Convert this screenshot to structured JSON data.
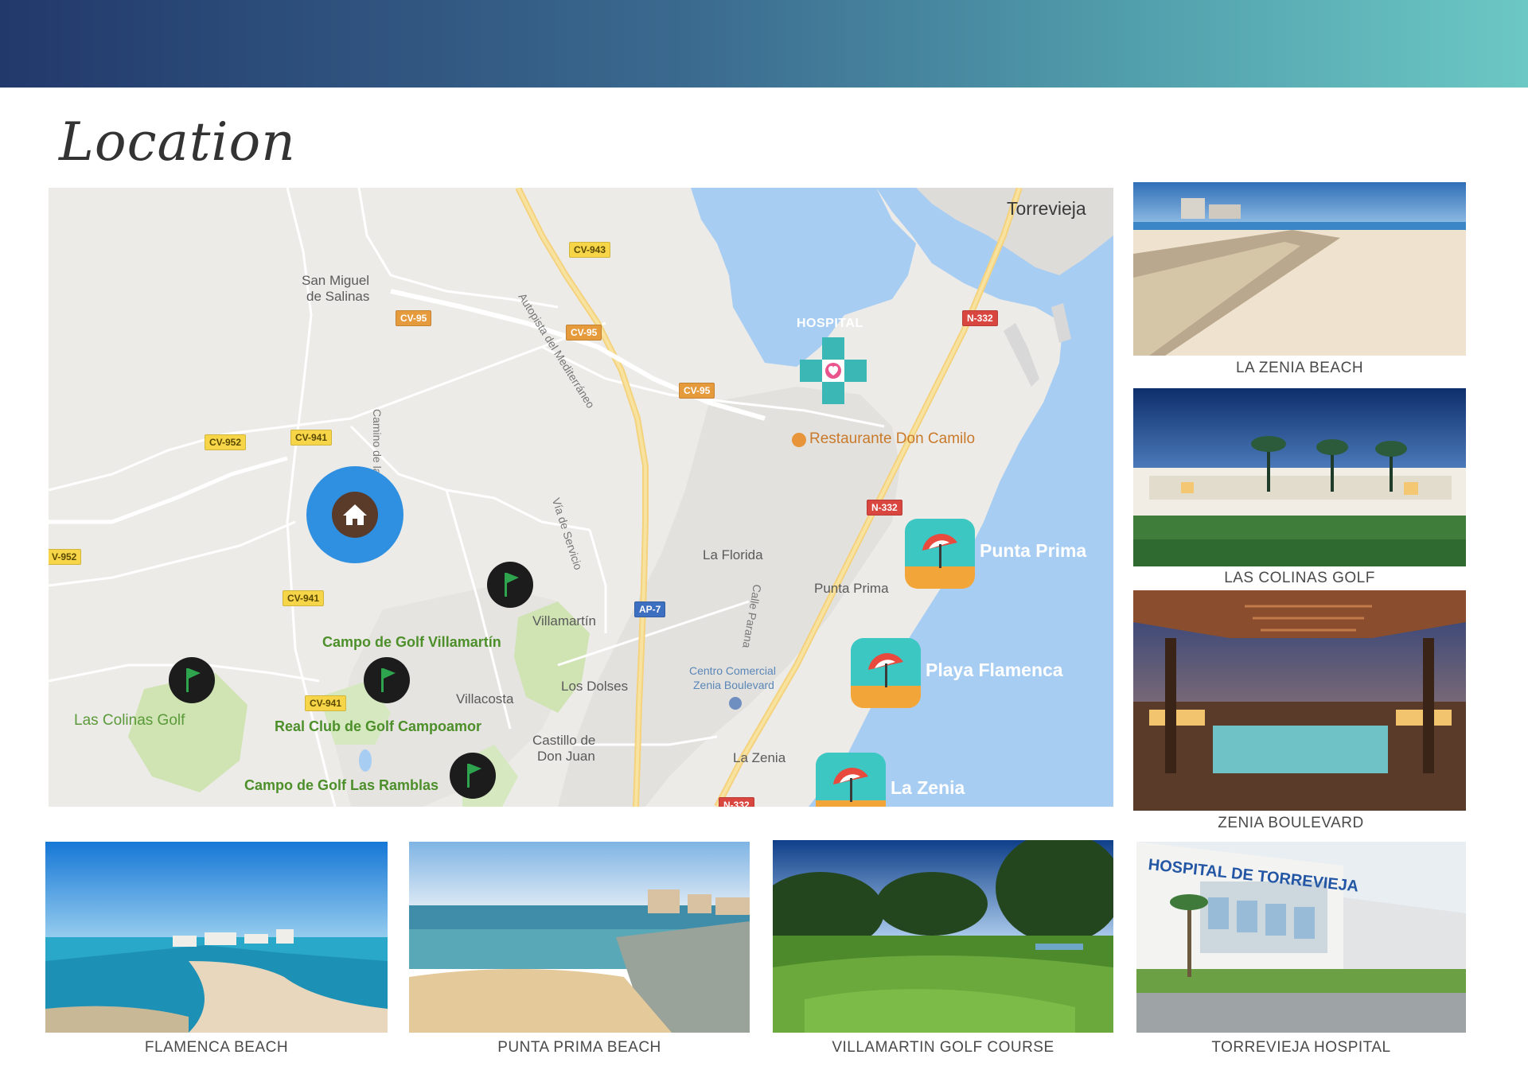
{
  "page": {
    "title": "Location"
  },
  "colors": {
    "header_start": "#22396b",
    "header_end": "#6cc8c4",
    "home_marker": "#2f8fe0",
    "golf": "#4d8f2a",
    "beach_icon": "#3cc7c3",
    "sea": "#a8cdf3"
  },
  "map": {
    "cities": {
      "torrevieja": "Torrevieja"
    },
    "towns": {
      "san_miguel_line1": "San Miguel",
      "san_miguel_line2": "de Salinas",
      "la_florida": "La Florida",
      "punta_prima": "Punta Prima",
      "villamartin": "Villamartín",
      "los_dolses": "Los Dolses",
      "villacosta": "Villacosta",
      "castillo_line1": "Castillo de",
      "castillo_line2": "Don Juan",
      "la_zenia": "La Zenia"
    },
    "streets": {
      "autopista": "Autopista del Mediterráneo",
      "camino": "Camino de la",
      "via_servicio": "Vía de Servicio",
      "calle": "Calle Parana"
    },
    "roads": {
      "cv943": "CV-943",
      "cv95_a": "CV-95",
      "cv95_b": "CV-95",
      "cv95_c": "CV-95",
      "n332_a": "N-332",
      "n332_b": "N-332",
      "n332_c": "N-332",
      "cv952_a": "CV-952",
      "cv952_b": "V-952",
      "cv941_a": "CV-941",
      "cv941_b": "CV-941",
      "cv941_c": "CV-941",
      "ap7": "AP-7"
    },
    "pois": {
      "hospital": "HOSPITAL",
      "restaurant": "Restaurante Don Camilo",
      "mall_line1": "Centro Comercial",
      "mall_line2": "Zenia Boulevard"
    },
    "golf": {
      "villamartin": "Campo de Golf Villamartín",
      "campoamor": "Real Club de Golf Campoamor",
      "las_ramblas": "Campo de Golf Las Ramblas",
      "las_colinas": "Las Colinas Golf"
    },
    "beaches": {
      "punta_prima": "Punta Prima",
      "playa_flamenca": "Playa Flamenca",
      "la_zenia": "La Zenia"
    },
    "icons": {
      "home": "home-icon",
      "flag": "golf-flag-icon",
      "umbrella": "beach-umbrella-icon",
      "hospital": "hospital-cross-icon"
    }
  },
  "photos": {
    "la_zenia_beach": "LA ZENIA BEACH",
    "las_colinas_golf": "LAS COLINAS GOLF",
    "zenia_boulevard": "ZENIA BOULEVARD",
    "flamenca_beach": "FLAMENCA BEACH",
    "punta_prima_beach": "PUNTA PRIMA BEACH",
    "villamartin_golf": "VILLAMARTIN GOLF COURSE",
    "torrevieja_hospital": "TORREVIEJA HOSPITAL",
    "hospital_sign": "HOSPITAL DE TORREVIEJA"
  }
}
